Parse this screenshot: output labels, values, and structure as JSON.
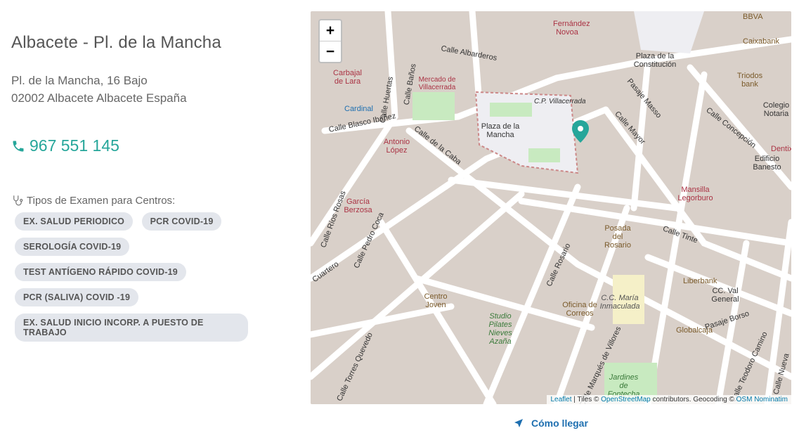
{
  "center": {
    "title": "Albacete - Pl. de la Mancha",
    "address_line1": "Pl. de la Mancha, 16 Bajo",
    "address_line2": "02002 Albacete Albacete España",
    "phone": "967 551 145",
    "exam_types_label": "Tipos de Examen para Centros:",
    "exam_types": [
      "EX. SALUD PERIODICO",
      "PCR COVID-19",
      "SEROLOGÍA COVID-19",
      "TEST ANTÍGENO RÁPIDO COVID-19",
      "PCR (SALIVA) COVID -19",
      "EX. SALUD INICIO  INCORP. A PUESTO DE TRABAJO"
    ]
  },
  "map": {
    "zoom_in": "+",
    "zoom_out": "−",
    "labels": {
      "plaza": "Plaza de la Mancha",
      "mercado": "Mercado de Villacerrada",
      "constitucion": "Plaza de la Constitución",
      "albarderos": "Calle Albarderos",
      "blasco": "Calle Blasco Ibáñez",
      "caba": "Calle de la Caba",
      "rosario": "Calle Rosario",
      "tinte": "Calle Tinte",
      "mayor": "Calle Mayor",
      "concepcion": "Calle Concepción",
      "correos": "Oficina de Correos",
      "centro_joven": "Centro Joven",
      "posada": "Posada del Rosario",
      "fontecha": "Jardines de Fontecha",
      "inmaculada": "C.C. María Inmaculada",
      "villacerrada": "C.P. Villacerrada",
      "carbajal": "Carbajal de Lara",
      "antonio": "Antonio López",
      "garcia": "García Berzosa",
      "mansilla": "Mansilla Legorburo",
      "pedro_coca": "Calle Pedro Coca",
      "rios_rosas": "Calle Ríos Rosas",
      "torres_quevedo": "Calle Torres Quevedo",
      "marques": "Calle Marqués de Villores",
      "pasaje_masso": "Pasaje Masso",
      "pasaje_borso": "Pasaje Borso",
      "liberbank": "Liberbank",
      "cc_val": "CC. Val General",
      "globalcaja": "Globalcaja",
      "triodos": "Triodos bank",
      "caixabank": "Caixabank",
      "huertas": "Calle Huertas",
      "banos": "Calle Baños",
      "cardinal": "Cardinal",
      "fernandez": "Fernández Novoa",
      "studio": "Studio Pilates Nieves Azaña",
      "edificio": "Edificio Banesto",
      "colegio": "Colegio Notaria",
      "dentix": "Dentix",
      "bbva": "BBVA",
      "teodoro": "Calle Teodoro Camino",
      "nueva": "Calle Nueva",
      "cuartero": "Cuartero"
    },
    "attribution": {
      "leaflet": "Leaflet",
      "tiles_prefix": "| Tiles ©",
      "osm": "OpenStreetMap",
      "mid": "contributors. Geocoding ©",
      "nominatim": "OSM Nominatim"
    },
    "colors": {
      "marker": "#26a69a",
      "road": "#ffffff",
      "block": "#d9d0c9",
      "park": "#c8eac0"
    }
  },
  "directions_label": "Cómo llegar",
  "accent_color": "#26a69a"
}
